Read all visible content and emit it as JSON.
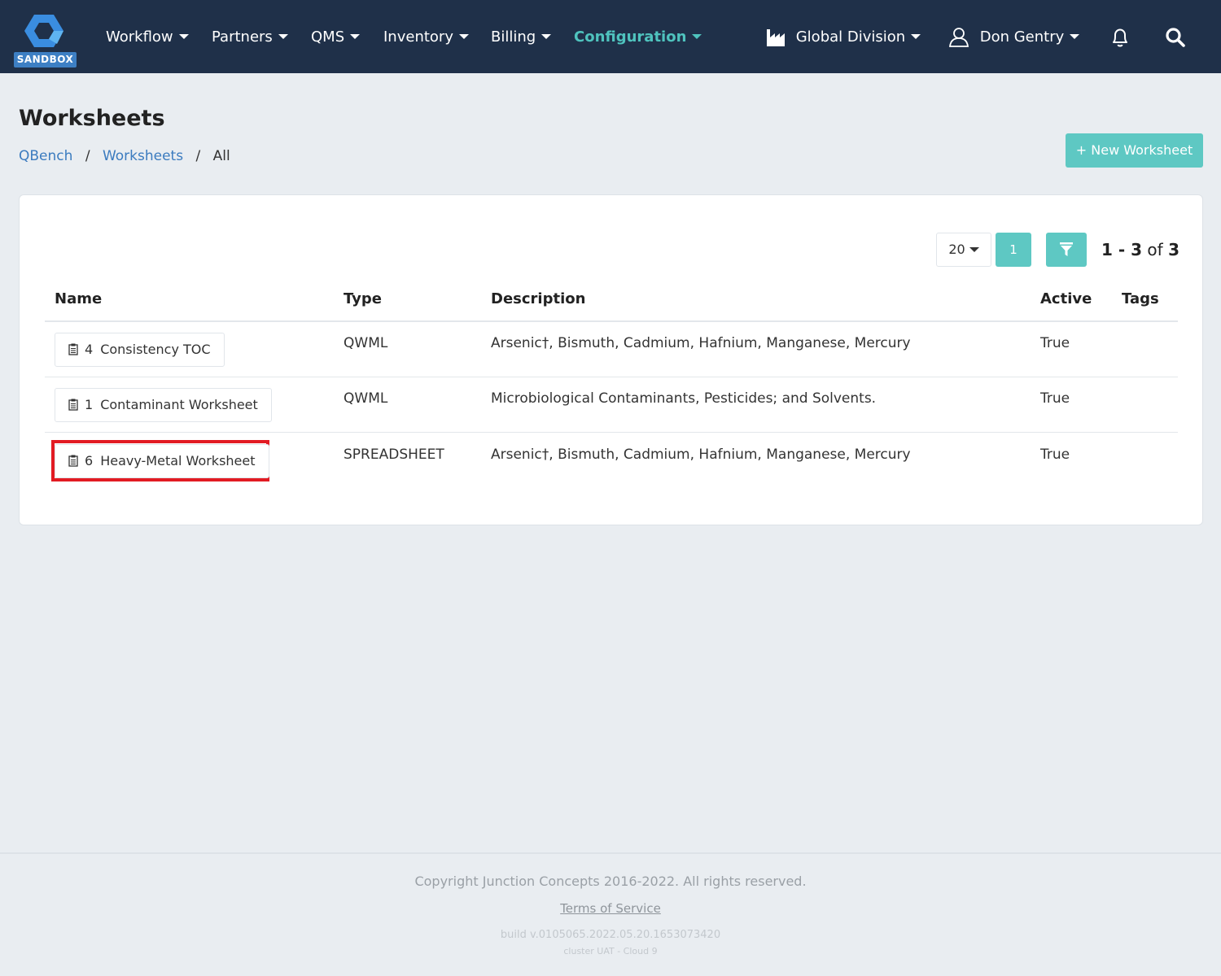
{
  "nav": {
    "badge": "SANDBOX",
    "items": [
      {
        "label": "Workflow"
      },
      {
        "label": "Partners"
      },
      {
        "label": "QMS"
      },
      {
        "label": "Inventory"
      },
      {
        "label": "Billing"
      },
      {
        "label": "Configuration"
      }
    ],
    "active_item": "Configuration",
    "division": "Global Division",
    "user": "Don Gentry",
    "icons": [
      "factory-icon",
      "user-icon",
      "bell-icon",
      "search-icon"
    ],
    "accent_color": "#4fc3be",
    "bg_color": "#1f3049"
  },
  "page": {
    "title": "Worksheets",
    "breadcrumb": [
      "QBench",
      "Worksheets",
      "All"
    ],
    "breadcrumb_sep": "/",
    "new_button": "+ New Worksheet"
  },
  "pagination": {
    "per_page": "20",
    "current_page": "1",
    "range": "1 - 3",
    "of_label": "of",
    "total": "3"
  },
  "table": {
    "headers": [
      "Name",
      "Type",
      "Description",
      "Active",
      "Tags"
    ],
    "rows": [
      {
        "id": "4",
        "name": "Consistency TOC",
        "type": "QWML",
        "description": "Arsenic†, Bismuth, Cadmium, Hafnium, Manganese, Mercury",
        "active": "True",
        "tags": "",
        "highlighted": false
      },
      {
        "id": "1",
        "name": "Contaminant Worksheet",
        "type": "QWML",
        "description": "Microbiological Contaminants, Pesticides; and Solvents.",
        "active": "True",
        "tags": "",
        "highlighted": false
      },
      {
        "id": "6",
        "name": "Heavy-Metal Worksheet",
        "type": "SPREADSHEET",
        "description": "Arsenic†, Bismuth, Cadmium, Hafnium, Manganese, Mercury",
        "active": "True",
        "tags": "",
        "highlighted": true
      }
    ]
  },
  "footer": {
    "copyright": "Copyright Junction Concepts 2016-2022. All rights reserved.",
    "terms": "Terms of Service",
    "build": "build v.0105065.2022.05.20.1653073420",
    "cluster": "cluster UAT - Cloud 9"
  }
}
